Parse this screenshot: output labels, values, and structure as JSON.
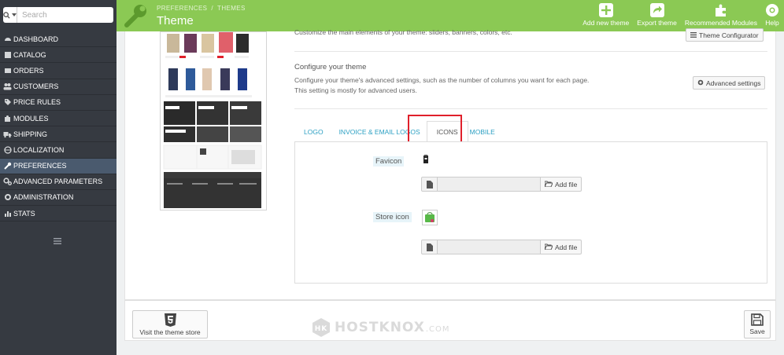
{
  "search": {
    "placeholder": "Search"
  },
  "sidebar": {
    "items": [
      {
        "label": "DASHBOARD",
        "icon": "dashboard-icon"
      },
      {
        "label": "CATALOG",
        "icon": "catalog-icon"
      },
      {
        "label": "ORDERS",
        "icon": "orders-icon"
      },
      {
        "label": "CUSTOMERS",
        "icon": "customers-icon"
      },
      {
        "label": "PRICE RULES",
        "icon": "price-tag-icon"
      },
      {
        "label": "MODULES",
        "icon": "puzzle-icon"
      },
      {
        "label": "SHIPPING",
        "icon": "truck-icon"
      },
      {
        "label": "LOCALIZATION",
        "icon": "globe-icon"
      },
      {
        "label": "PREFERENCES",
        "icon": "wrench-icon",
        "active": true
      },
      {
        "label": "ADVANCED PARAMETERS",
        "icon": "cogs-icon"
      },
      {
        "label": "ADMINISTRATION",
        "icon": "gear-icon"
      },
      {
        "label": "STATS",
        "icon": "bar-chart-icon"
      }
    ]
  },
  "header": {
    "breadcrumb": [
      "PREFERENCES",
      "THEMES"
    ],
    "separator": "/",
    "title": "Theme",
    "accent": "#8bc954",
    "toolbar": {
      "add_new_theme": "Add new theme",
      "export_theme": "Export theme",
      "recommended_modules": "Recommended Modules",
      "help": "Help"
    }
  },
  "main": {
    "customize_text": "Customize the main elements of your theme: sliders, banners, colors, etc.",
    "theme_configurator_button": "Theme Configurator",
    "configure_title": "Configure your theme",
    "configure_desc": "Configure your theme's advanced settings, such as the number of columns you want for each page. This setting is mostly for advanced users.",
    "advanced_settings_button": "Advanced settings",
    "tabs": [
      {
        "label": "LOGO"
      },
      {
        "label": "INVOICE & EMAIL LOGOS"
      },
      {
        "label": "ICONS",
        "active": true
      },
      {
        "label": "MOBILE"
      }
    ],
    "favicon_label": "Favicon",
    "store_icon_label": "Store icon",
    "add_file_label": "Add file",
    "highlight_color": "#e0202b"
  },
  "footer": {
    "theme_store_button": "Visit the theme store",
    "save_button": "Save",
    "watermark_logo": "HK",
    "watermark": "HOSTKNOX",
    "watermark_tld": ".COM"
  }
}
